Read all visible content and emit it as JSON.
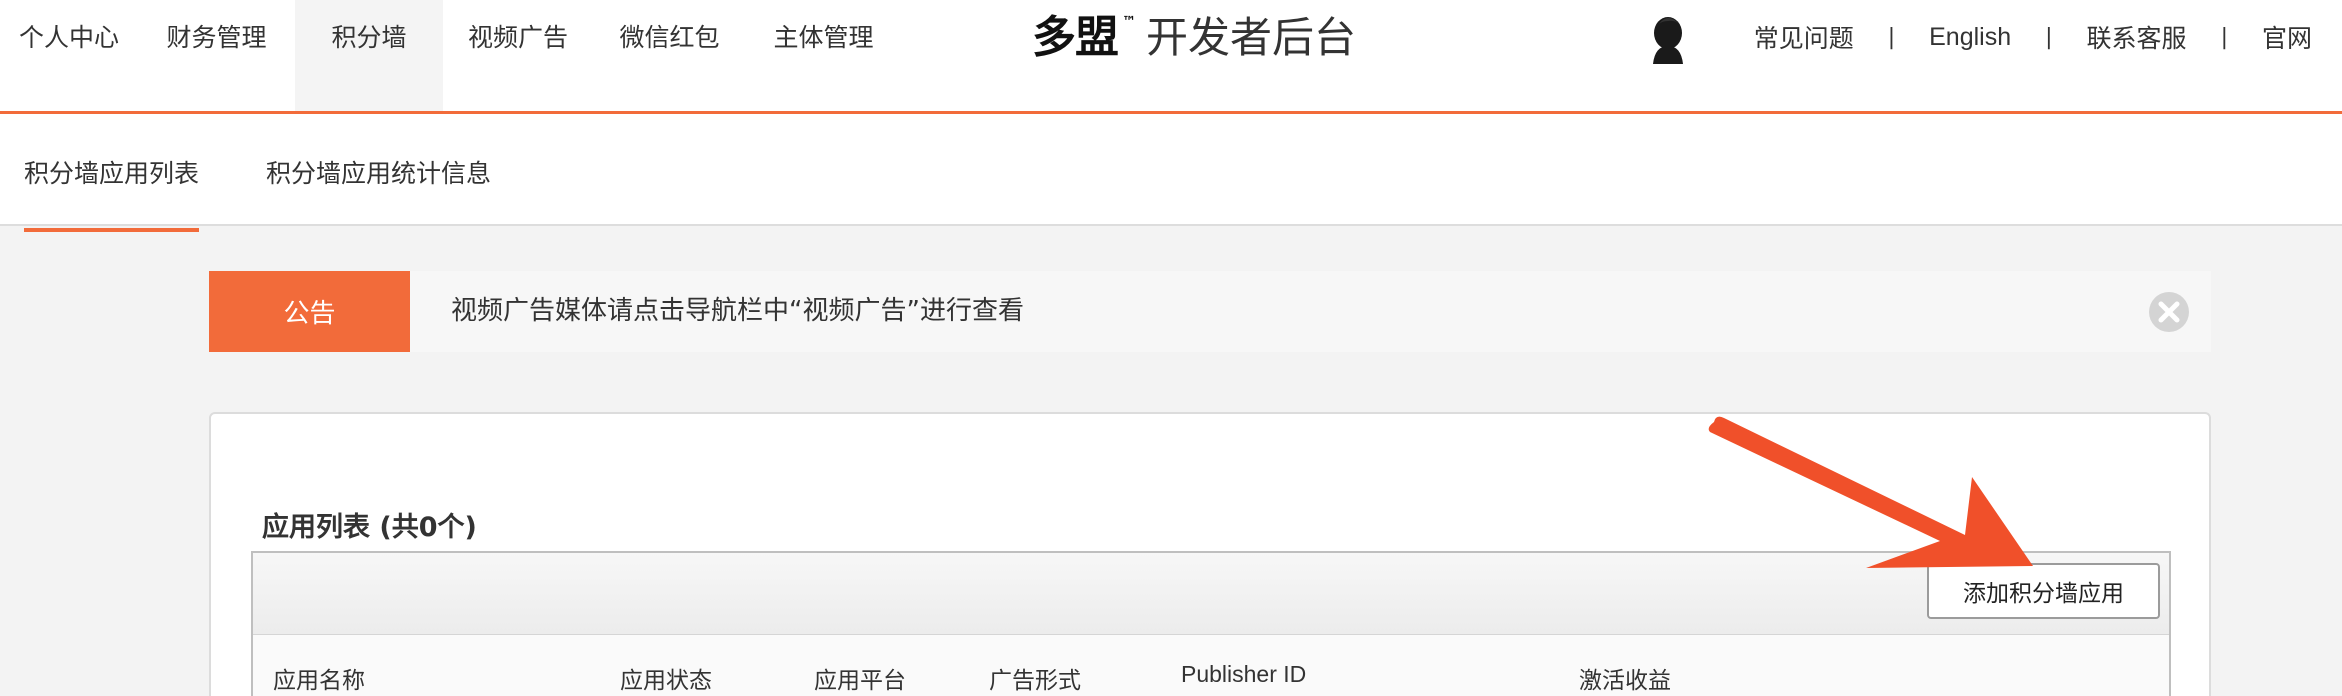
{
  "topnav": {
    "items": [
      {
        "label": "个人中心"
      },
      {
        "label": "财务管理"
      },
      {
        "label": "积分墙",
        "active": true
      },
      {
        "label": "视频广告"
      },
      {
        "label": "微信红包"
      },
      {
        "label": "主体管理"
      }
    ]
  },
  "brand": {
    "logo": "多盟",
    "tm": "™",
    "title": "开发者后台"
  },
  "rightnav": {
    "items": [
      {
        "label": "常见问题"
      },
      {
        "label": "English"
      },
      {
        "label": "联系客服"
      },
      {
        "label": "官网"
      }
    ],
    "separator": "|"
  },
  "subnav": {
    "items": [
      {
        "label": "积分墙应用列表",
        "active": true
      },
      {
        "label": "积分墙应用统计信息"
      }
    ]
  },
  "notice": {
    "tag": "公告",
    "text": "视频广告媒体请点击导航栏中“视频广告”进行查看",
    "close_icon": "close-circle-icon"
  },
  "app_list": {
    "title": "应用列表 (共0个)",
    "add_button": "添加积分墙应用",
    "columns": [
      "应用名称",
      "应用状态",
      "应用平台",
      "广告形式",
      "Publisher ID",
      "激活收益"
    ]
  },
  "colors": {
    "accent": "#f26b3a",
    "annotation_arrow": "#f0502a"
  }
}
